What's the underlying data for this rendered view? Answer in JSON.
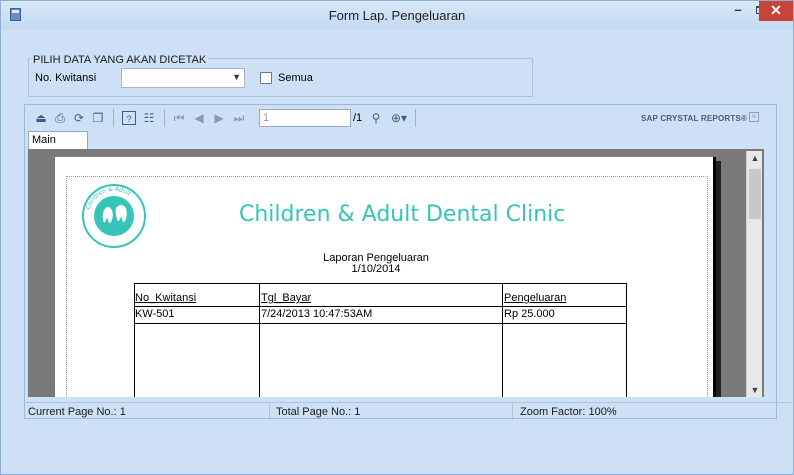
{
  "window": {
    "title": "Form Lap. Pengeluaran",
    "minimize_label": "–",
    "close_label": "✕"
  },
  "filter": {
    "group_title": "PILIH DATA YANG AKAN DICETAK",
    "kwitansi_label": "No. Kwitansi",
    "kwitansi_value": "",
    "semua_label": "Semua",
    "semua_checked": false
  },
  "toolbar": {
    "icons": [
      "export-icon",
      "print-icon",
      "refresh-icon",
      "copy-icon",
      "help-icon",
      "group-tree-icon",
      "first-page-icon",
      "prev-page-icon",
      "next-page-icon",
      "last-page-icon",
      "find-icon",
      "zoom-icon"
    ],
    "page_value": "1",
    "page_total": "/1",
    "brand": "SAP CRYSTAL REPORTS®"
  },
  "tabs": [
    "Main Report"
  ],
  "report": {
    "clinic_name": "Children & Adult Dental Clinic",
    "title": "Laporan Pengeluaran",
    "date": "1/10/2014",
    "columns": [
      "No_Kwitansi",
      "Tgl_Bayar",
      "Pengeluaran"
    ],
    "rows": [
      [
        "KW-501",
        "7/24/2013  10:47:53AM",
        "Rp 25.000"
      ]
    ],
    "logo_text": "Children & Adult Dental Clinic"
  },
  "status": {
    "current_page": "Current Page No.: 1",
    "total_page": "Total Page No.: 1",
    "zoom": "Zoom Factor: 100%"
  },
  "colors": {
    "window_bg": "#cde0f5",
    "clinic_accent": "#35c4b7",
    "close_button": "#c7443b"
  }
}
